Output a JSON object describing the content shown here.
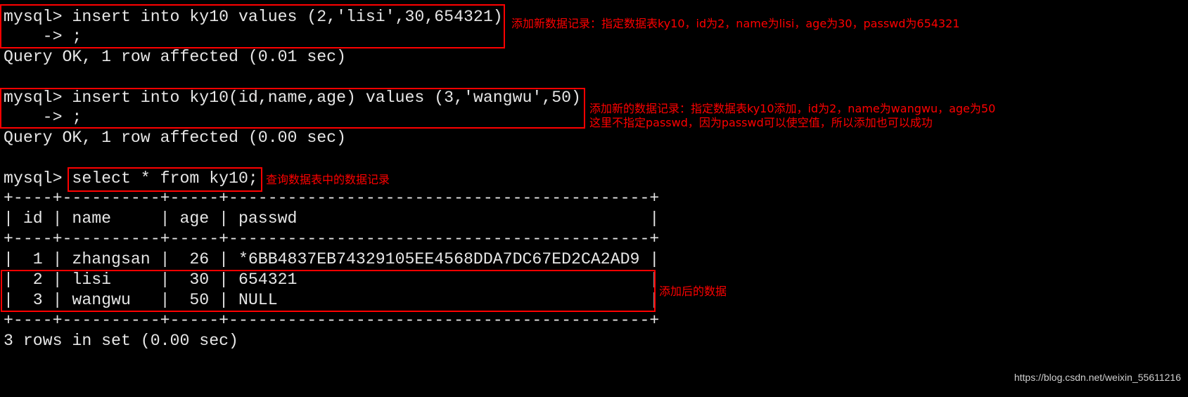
{
  "terminal": {
    "lines": [
      "mysql> insert into ky10 values (2,'lisi',30,654321)",
      "    -> ;",
      "Query OK, 1 row affected (0.01 sec)",
      "",
      "mysql> insert into ky10(id,name,age) values (3,'wangwu',50)",
      "    -> ;",
      "Query OK, 1 row affected (0.00 sec)",
      "",
      "mysql> select * from ky10;",
      "+----+----------+-----+-------------------------------------------+",
      "| id | name     | age | passwd                                    |",
      "+----+----------+-----+-------------------------------------------+",
      "|  1 | zhangsan |  26 | *6BB4837EB74329105EE4568DDA7DC67ED2CA2AD9 |",
      "|  2 | lisi     |  30 | 654321                                    |",
      "|  3 | wangwu   |  50 | NULL                                      |",
      "+----+----------+-----+-------------------------------------------+",
      "3 rows in set (0.00 sec)"
    ],
    "query_table": {
      "columns": [
        "id",
        "name",
        "age",
        "passwd"
      ],
      "rows": [
        [
          "1",
          "zhangsan",
          "26",
          "*6BB4837EB74329105EE4568DDA7DC67ED2CA2AD9"
        ],
        [
          "2",
          "lisi",
          "30",
          "654321"
        ],
        [
          "3",
          "wangwu",
          "50",
          "NULL"
        ]
      ]
    }
  },
  "annotations": {
    "insert_lisi": "添加新数据记录：指定数据表ky10，id为2，name为lisi，age为30，passwd为654321",
    "insert_wangwu_1": "添加新的数据记录：指定数据表ky10添加，id为2，name为wangwu，age为50",
    "insert_wangwu_2": "这里不指定passwd，因为passwd可以使空值，所以添加也可以成功",
    "select": "查询数据表中的数据记录",
    "added_rows": "添加后的数据"
  },
  "colors": {
    "background": "#000000",
    "terminal_text": "#e6e6e6",
    "highlight": "#ff0000"
  },
  "watermark": "https://blog.csdn.net/weixin_55611216"
}
